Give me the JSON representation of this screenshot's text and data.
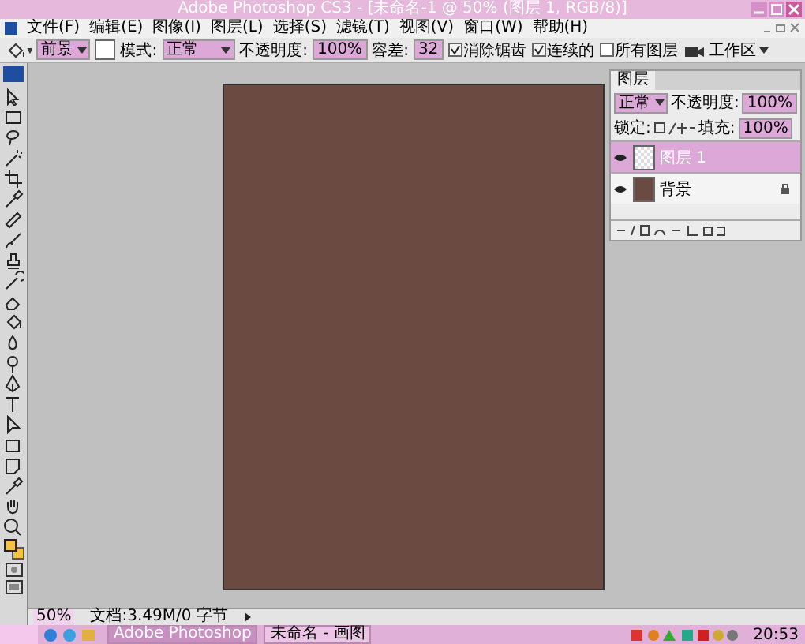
{
  "window": {
    "title": "Adobe Photoshop CS3 - [未命名-1 @ 50% (图层 1, RGB/8)]"
  },
  "menu": [
    "文件(F)",
    "编辑(E)",
    "图像(I)",
    "图层(L)",
    "选择(S)",
    "滤镜(T)",
    "视图(V)",
    "窗口(W)",
    "帮助(H)"
  ],
  "options": {
    "fill_source": "前景",
    "mode_label": "模式:",
    "mode": "正常",
    "opacity_label": "不透明度:",
    "opacity": "100%",
    "tolerance_label": "容差:",
    "tolerance": "32",
    "checkboxes": [
      {
        "label": "消除锯齿",
        "checked": true
      },
      {
        "label": "连续的",
        "checked": true
      },
      {
        "label": "所有图层",
        "checked": false
      }
    ],
    "workspace": "工作区"
  },
  "layers_panel": {
    "tab": "图层",
    "blend_mode": "正常",
    "opacity_label": "不透明度:",
    "opacity": "100%",
    "lock_label": "锁定:",
    "fill_label": "填充:",
    "fill": "100%",
    "layers": [
      {
        "name": "图层 1",
        "kind": "transparent",
        "visible": true,
        "selected": true,
        "locked": false
      },
      {
        "name": "背景",
        "kind": "filled",
        "visible": true,
        "selected": false,
        "locked": true
      }
    ]
  },
  "status_bar": {
    "zoom": "50%",
    "document": "文档:3.49M/0 字节"
  },
  "taskbar": {
    "tasks": [
      {
        "label": "Adobe Photoshop",
        "selected": true
      },
      {
        "label": "未命名 - 画图",
        "selected": false
      }
    ],
    "clock": "20:53"
  }
}
